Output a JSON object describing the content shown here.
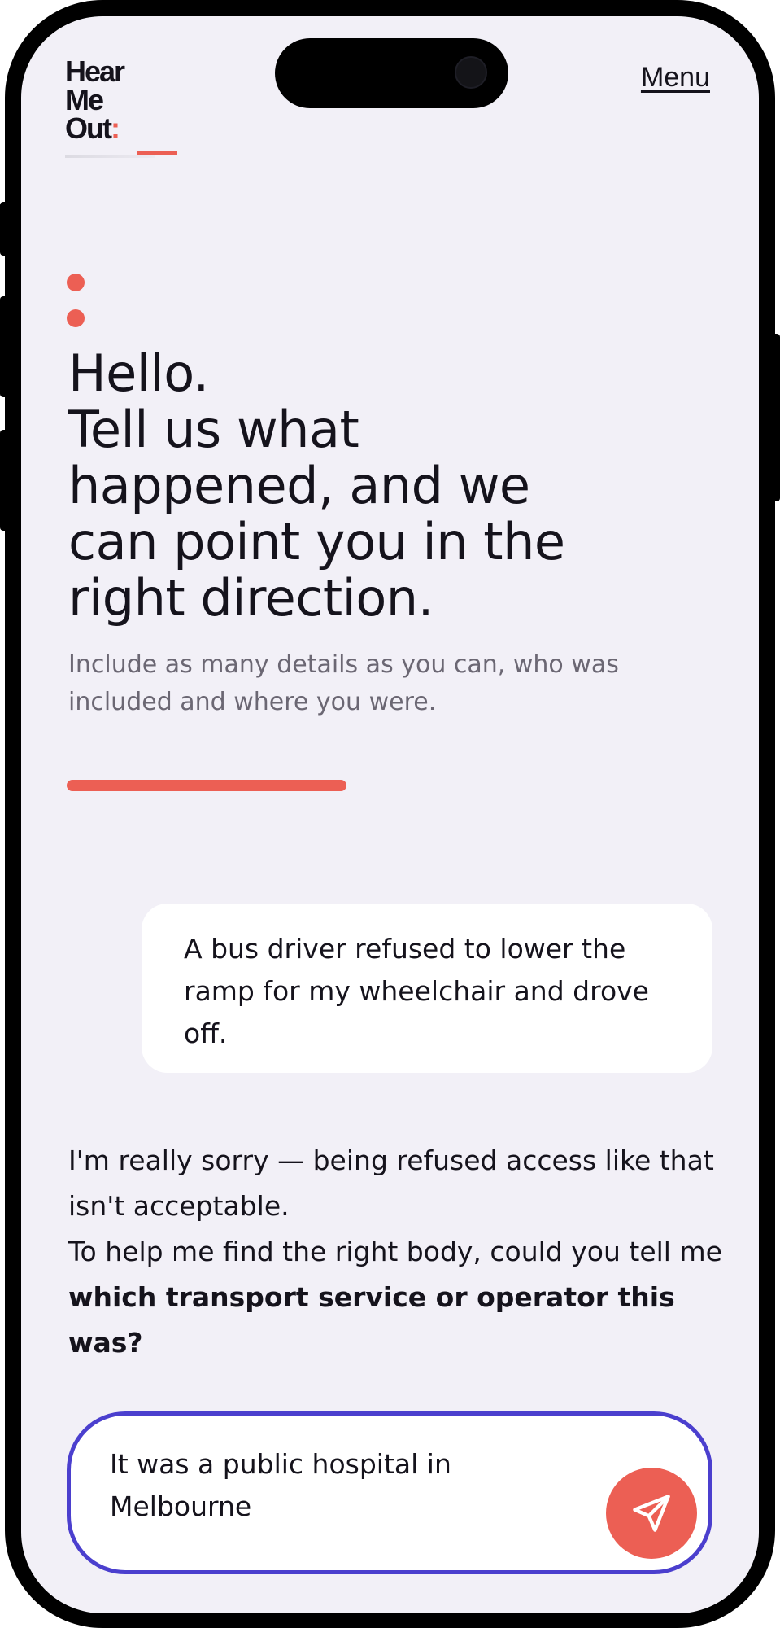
{
  "header": {
    "logo": {
      "line1": "Hear",
      "line2": "Me",
      "line3": "Out",
      "colon": ":"
    },
    "menu_label": "Menu"
  },
  "intro": {
    "headline_line1": "Hello.",
    "headline_line2": "Tell us what",
    "headline_line3": "happened, and we",
    "headline_line4": "can point you in the",
    "headline_line5": "right direction.",
    "subtext": "Include as many details as you can, who was included and where you were.",
    "progress_fraction": 0.36
  },
  "conversation": {
    "user_message": "A bus driver refused to lower the ramp for my wheelchair and drove off.",
    "assistant_line1": "I'm really sorry — being refused access like that isn't acceptable.",
    "assistant_line2_prefix": "To help me find the right body, could you tell me ",
    "assistant_line2_bold": "which transport service or operator this was?"
  },
  "composer": {
    "input_value": "It was a public hospital in Melbourne",
    "send_icon": "send-paper-plane-icon"
  },
  "colors": {
    "accent": "#ec5f54",
    "focus_border": "#4b3fce",
    "background": "#f2f0f7",
    "text": "#15131c",
    "muted_text": "#6b6773"
  }
}
